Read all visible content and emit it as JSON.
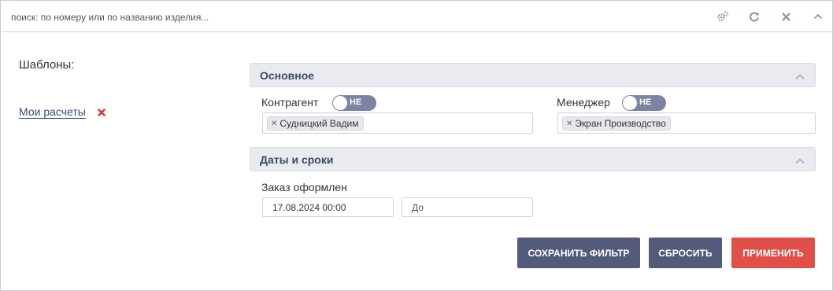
{
  "search": {
    "placeholder": "поиск: по номеру или по названию изделия..."
  },
  "toolbar": {
    "icons": [
      "settings-icon",
      "refresh-icon",
      "close-icon",
      "chevron-up-icon"
    ]
  },
  "templates": {
    "title": "Шаблоны:",
    "items": [
      {
        "label": "Мои расчеты"
      }
    ]
  },
  "sections": {
    "main": {
      "title": "Основное",
      "contractor": {
        "label": "Контрагент",
        "toggle_label": "НЕ",
        "tags": [
          "Судницкий Вадим"
        ]
      },
      "manager": {
        "label": "Менеджер",
        "toggle_label": "НЕ",
        "tags": [
          "Экран Производство"
        ]
      }
    },
    "dates": {
      "title": "Даты и сроки",
      "order_placed": {
        "label": "Заказ оформлен",
        "from_value": "17.08.2024 00:00",
        "to_placeholder": "До"
      }
    }
  },
  "buttons": {
    "save_filter": "СОХРАНИТЬ ФИЛЬТР",
    "reset": "СБРОСИТЬ",
    "apply": "ПРИМЕНИТЬ"
  },
  "colors": {
    "section_header_bg": "#e9ebf0",
    "button_dark": "#545b7a",
    "button_apply": "#e0504a",
    "toggle_bg": "#7b84a1",
    "remove_icon": "#d9343a",
    "link": "#3a4a7a"
  }
}
